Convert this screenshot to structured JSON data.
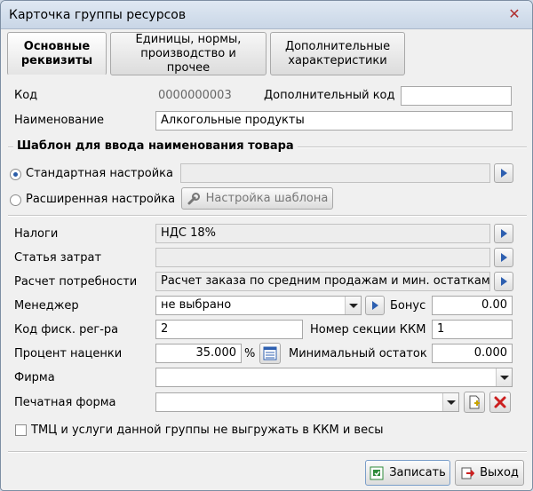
{
  "window": {
    "title": "Карточка группы ресурсов"
  },
  "tabs": [
    {
      "label": "Основные реквизиты"
    },
    {
      "label": "Единицы, нормы, производство и прочее"
    },
    {
      "label": "Дополнительные характеристики"
    }
  ],
  "code": {
    "label": "Код",
    "value": "0000000003"
  },
  "extra_code": {
    "label": "Дополнительный код",
    "value": ""
  },
  "name": {
    "label": "Наименование",
    "value": "Алкогольные продукты"
  },
  "template_group": {
    "title": "Шаблон для ввода наименования товара",
    "standard_label": "Стандартная настройка",
    "extended_label": "Расширенная настройка",
    "template_button": "Настройка шаблона",
    "selected": "standard"
  },
  "taxes": {
    "label": "Налоги",
    "value": "НДС 18%"
  },
  "cost_item": {
    "label": "Статья затрат",
    "value": ""
  },
  "demand_calc": {
    "label": "Расчет потребности",
    "value": "Расчет заказа по средним продажам и мин. остаткам с уче"
  },
  "manager": {
    "label": "Менеджер",
    "value": "не выбрано"
  },
  "bonus": {
    "label": "Бонус",
    "value": "0.00"
  },
  "fiscal_code": {
    "label": "Код фиск. рег-ра",
    "value": "2"
  },
  "kkm_section": {
    "label": "Номер секции ККМ",
    "value": "1"
  },
  "markup": {
    "label": "Процент наценки",
    "value": "35.000",
    "unit": "%"
  },
  "min_stock": {
    "label": "Минимальный остаток",
    "value": "0.000"
  },
  "firm": {
    "label": "Фирма",
    "value": ""
  },
  "print_form": {
    "label": "Печатная форма",
    "value": ""
  },
  "no_export": {
    "label": "ТМЦ и услуги данной группы не выгружать в ККМ и весы",
    "checked": false
  },
  "footer": {
    "save_label": "Записать",
    "exit_label": "Выход"
  },
  "colors": {
    "accent": "#2d5fb0",
    "delete": "#cc1f1f",
    "save_icon": "#2e8b3a"
  }
}
